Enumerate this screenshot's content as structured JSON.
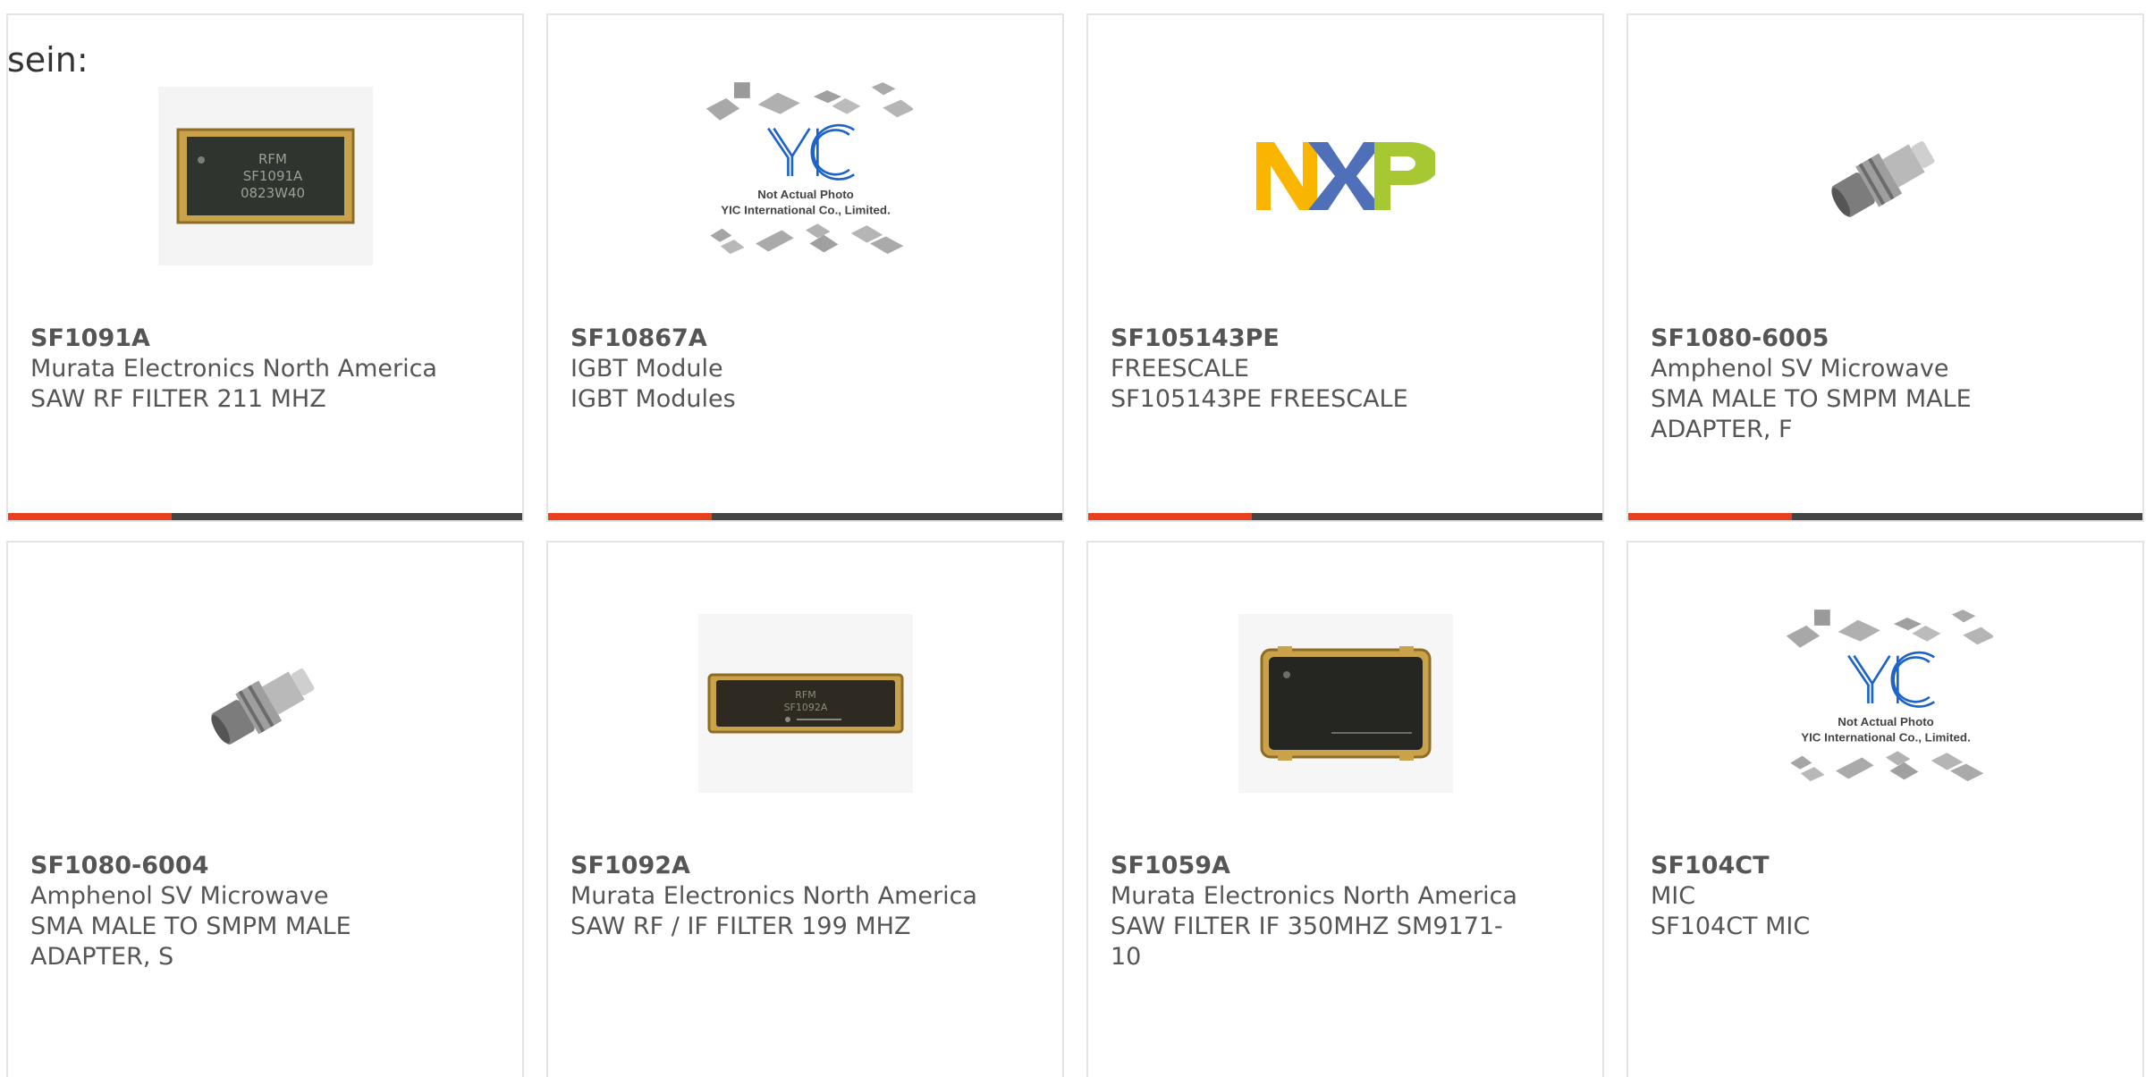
{
  "page": {
    "heading": "sein:"
  },
  "products": [
    {
      "part_number": "SF1091A",
      "manufacturer": "Murata Electronics North America",
      "desc_line1": "SAW RF FILTER 211 MHZ",
      "desc_line2": "",
      "image": "saw-filter-chip-photo"
    },
    {
      "part_number": "SF10867A",
      "manufacturer": "IGBT Module",
      "desc_line1": "IGBT Modules",
      "desc_line2": "",
      "image": "not-actual-photo-placeholder",
      "placeholder_line1": "Not Actual Photo",
      "placeholder_line2": "YIC International Co., Limited.",
      "placeholder_logo": "YIC"
    },
    {
      "part_number": "SF105143PE",
      "manufacturer": "FREESCALE",
      "desc_line1": "SF105143PE FREESCALE",
      "desc_line2": "",
      "image": "nxp-logo",
      "logo_text": "NXP"
    },
    {
      "part_number": "SF1080-6005",
      "manufacturer": "Amphenol SV Microwave",
      "desc_line1": "SMA MALE TO SMPM MALE",
      "desc_line2": "ADAPTER, F",
      "image": "sma-adapter-photo"
    },
    {
      "part_number": "SF1080-6004",
      "manufacturer": "Amphenol SV Microwave",
      "desc_line1": "SMA MALE TO SMPM MALE",
      "desc_line2": "ADAPTER, S",
      "image": "sma-adapter-photo"
    },
    {
      "part_number": "SF1092A",
      "manufacturer": "Murata Electronics North America",
      "desc_line1": "SAW RF / IF FILTER 199 MHZ",
      "desc_line2": "",
      "image": "saw-filter-long-chip-photo"
    },
    {
      "part_number": "SF1059A",
      "manufacturer": "Murata Electronics North America",
      "desc_line1": "SAW FILTER IF 350MHZ SM9171-",
      "desc_line2": "10",
      "image": "smd-chip-photo"
    },
    {
      "part_number": "SF104CT",
      "manufacturer": "MIC",
      "desc_line1": "SF104CT MIC",
      "desc_line2": "",
      "image": "not-actual-photo-placeholder",
      "placeholder_line1": "Not Actual Photo",
      "placeholder_line2": "YIC International Co., Limited.",
      "placeholder_logo": "YIC"
    }
  ],
  "colors": {
    "accent": "#e8401c",
    "bar_dark": "#444444",
    "text": "#555555",
    "border": "#e4e4e4"
  }
}
